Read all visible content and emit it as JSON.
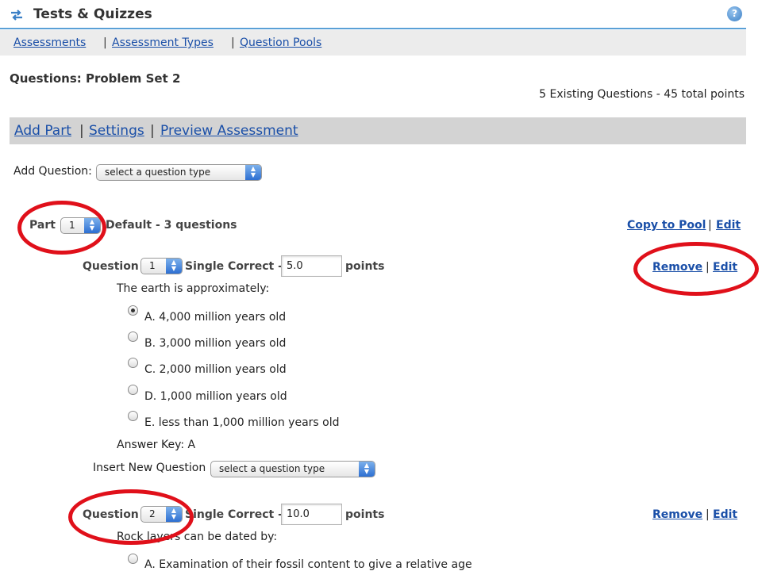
{
  "app": {
    "title": "Tests & Quizzes",
    "help_icon": "help-icon",
    "tool_icon": "swap-arrows-icon"
  },
  "nav": {
    "items": [
      "Assessments",
      "Assessment Types",
      "Question Pools"
    ],
    "separator": "|"
  },
  "page": {
    "title": "Questions: Problem Set 2",
    "summary": "5 Existing Questions - 45 total points"
  },
  "actions": {
    "items": [
      "Add Part",
      "Settings",
      "Preview Assessment"
    ],
    "separator": "|"
  },
  "add_question": {
    "label": "Add Question:",
    "select_value": "select a question type"
  },
  "part": {
    "label": "Part",
    "number": "1",
    "description": "Default - 3 questions",
    "links": {
      "copy": "Copy to Pool",
      "separator": "|",
      "edit": "Edit"
    }
  },
  "questions": [
    {
      "label": "Question",
      "number": "1",
      "type": "Single Correct -",
      "points": "5.0",
      "points_label": "points",
      "text": "The earth is approximately:",
      "choices": [
        "A. 4,000 million years old",
        "B. 3,000 million years old",
        "C. 2,000 million years old",
        "D. 1,000 million years old",
        "E. less than 1,000 million years old"
      ],
      "selected_index": 0,
      "answer_key": "Answer Key: A",
      "links": {
        "remove": "Remove",
        "separator": "|",
        "edit": "Edit"
      }
    },
    {
      "label": "Question",
      "number": "2",
      "type": "Single Correct -",
      "points": "10.0",
      "points_label": "points",
      "text": "Rock layers can be dated by:",
      "choices": [
        "A. Examination of their fossil content to give a relative age"
      ],
      "links": {
        "remove": "Remove",
        "separator": "|",
        "edit": "Edit"
      }
    }
  ],
  "insert_question": {
    "label": "Insert New Question",
    "select_value": "select a question type"
  },
  "colors": {
    "link": "#1a4fa8",
    "highlight": "#e0101a",
    "title_rule": "#5aa0d6",
    "action_bar": "#d3d3d3",
    "nav_bar": "#ececec"
  }
}
